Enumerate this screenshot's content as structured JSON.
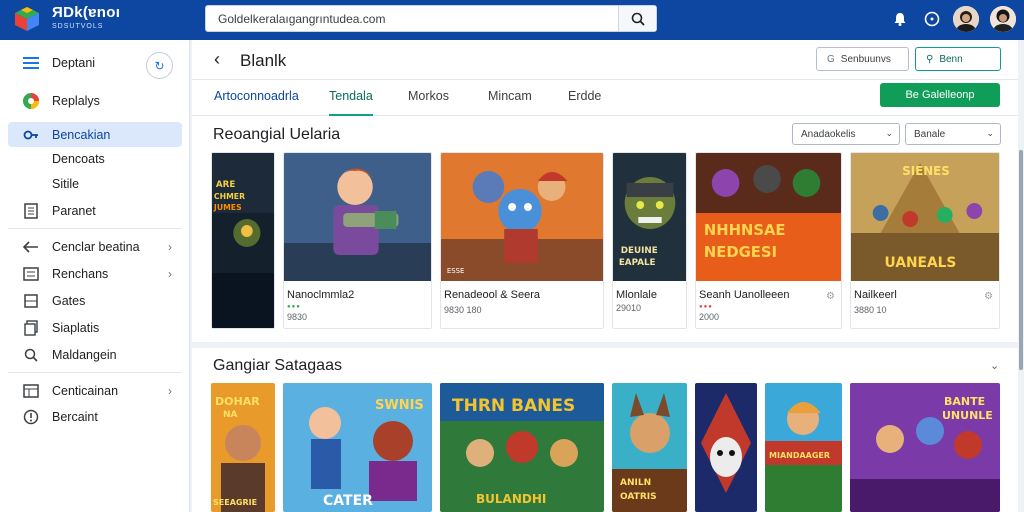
{
  "app": {
    "brand_main": "ЯDk(ɐnoı",
    "brand_sub": "SDSUTVOLS"
  },
  "search": {
    "value": "Goldelkeralaıgangrıntudea.com"
  },
  "sidebar": {
    "items": [
      {
        "label": "Deptani"
      },
      {
        "label": "Replalys"
      },
      {
        "label": "Bencakian"
      },
      {
        "label": "Dencoats"
      },
      {
        "label": "Sitile"
      },
      {
        "label": "Paranet"
      },
      {
        "label": "Cenclar beatina"
      },
      {
        "label": "Renchans"
      },
      {
        "label": "Gates"
      },
      {
        "label": "Siaplatis"
      },
      {
        "label": "Maldangein"
      },
      {
        "label": "Centicainan"
      },
      {
        "label": "Bercaint"
      }
    ]
  },
  "header": {
    "title": "Blanlk",
    "btn_secondary": "Senbuunvs",
    "btn_primary": "Benn"
  },
  "tabs": [
    {
      "label": "Artoconnoadrla"
    },
    {
      "label": "Tendala"
    },
    {
      "label": "Morkos"
    },
    {
      "label": "Mincam"
    },
    {
      "label": "Erdde"
    }
  ],
  "green_button": "Be Galelleonp",
  "section1": {
    "title": "Reoangial Uelaria",
    "dropdown1": "Anadaokelis",
    "dropdown2": "Banale"
  },
  "cards": [
    {
      "name": "",
      "meta": ""
    },
    {
      "name": "Nanoclmmla2",
      "meta": "9830"
    },
    {
      "name": "Renadeool & Seera",
      "meta": "9830 180"
    },
    {
      "name": "Mlonlale",
      "meta": "29010"
    },
    {
      "name": "Seanh Uanolleeen",
      "meta": "2000"
    },
    {
      "name": "Nailkeerl",
      "meta": "3880 10"
    }
  ],
  "art_text": {
    "c1": "ARE CHMER JUMES",
    "c3": "ESSE",
    "c4": "DEUINE EAPALE",
    "c5": "NHHNSAE NEDGESI",
    "c6_top": "SIENES",
    "c6_bottom": "UANEALS",
    "s1_top": "DOHAR NA",
    "s1_bottom": "SEEAGRIE",
    "s2_top": "SWNIS",
    "s2_bottom": "CATER",
    "s3_top": "THRN BANES",
    "s3_bottom": "BULANDHI",
    "s4": "ANILN OATRIS",
    "s6": "MIANDAAGER",
    "s7": "BANTE UNUNLE"
  },
  "section2": {
    "title": "Gangiar Satagaas"
  },
  "colors": {
    "topbar": "#0d47a1",
    "accent": "#0f9d58",
    "active_nav": "#dbe8fb"
  }
}
